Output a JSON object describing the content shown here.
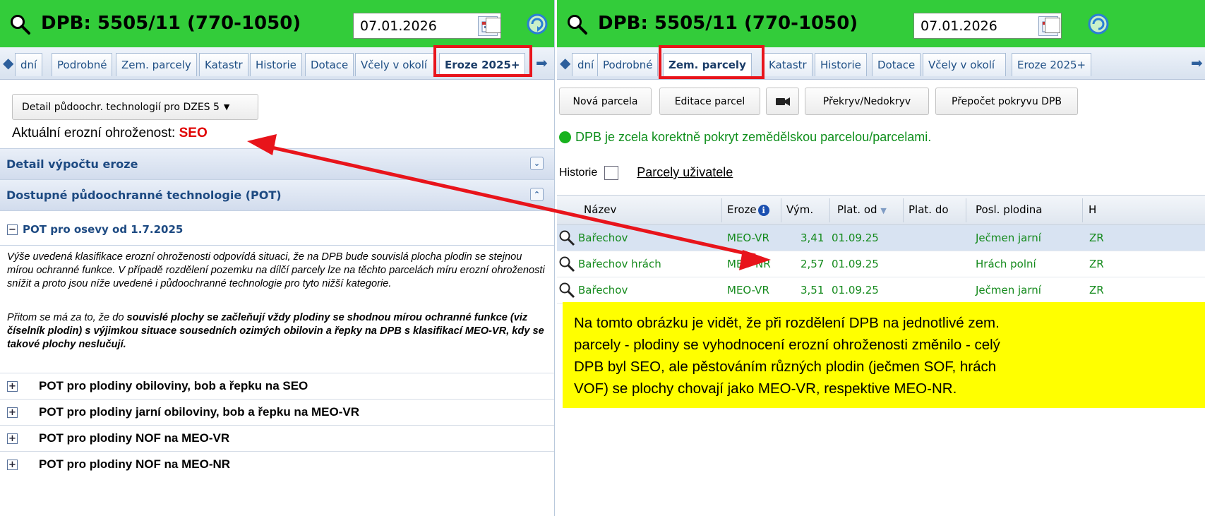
{
  "left": {
    "title": "DPB: 5505/11 (770-1050)",
    "date": "07.01.2026",
    "tabs": [
      "dní",
      "Podrobné",
      "Zem. parcely",
      "Katastr",
      "Historie",
      "Dotace",
      "Včely v okolí",
      "Eroze 2025+"
    ],
    "active_tab": "Eroze 2025+",
    "dropdown_label": "Detail půdoochr. technologií pro DZES 5",
    "erosion_label": "Aktuální erozní ohroženost:",
    "erosion_value": "SEO",
    "section_detail": "Detail výpočtu eroze",
    "section_pot": "Dostupné půdoochranné technologie (POT)",
    "pot_header": "POT pro osevy od 1.7.2025",
    "paragraph1": "Výše uvedená klasifikace erozní ohroženosti odpovídá situaci, že na DPB bude souvislá plocha plodin se stejnou mírou ochranné funkce. V případě rozdělení pozemku na dílčí parcely lze na těchto parcelách míru erozní ohroženosti snížit a proto jsou níže uvedené i půdoochranné technologie pro tyto nižší kategorie.",
    "paragraph2_start": "Přitom se má za to, že do ",
    "paragraph2_bold": "souvislé plochy se začleňují vždy plodiny se shodnou mírou ochranné funkce (viz číselník plodin) s výjimkou situace sousedních ozimých obilovin a řepky na DPB s klasifikací MEO-VR, kdy se takové plochy neslučují.",
    "pot_rows": [
      "POT pro plodiny obiloviny, bob a řepku na SEO",
      "POT pro plodiny jarní obiloviny, bob a řepku na MEO-VR",
      "POT pro plodiny NOF na MEO-VR",
      "POT pro plodiny NOF na MEO-NR"
    ]
  },
  "right": {
    "title": "DPB: 5505/11 (770-1050)",
    "date": "07.01.2026",
    "tabs": [
      "dní",
      "Podrobné",
      "Zem. parcely",
      "Katastr",
      "Historie",
      "Dotace",
      "Včely v okolí",
      "Eroze 2025+"
    ],
    "active_tab": "Zem. parcely",
    "buttons": {
      "new_parcel": "Nová parcela",
      "edit_parcels": "Editace parcel",
      "overlap": "Překryv/Nedokryv",
      "recalc": "Přepočet pokryvu DPB"
    },
    "status": "DPB je zcela korektně pokryt zemědělskou parcelou/parcelami.",
    "history_label": "Historie",
    "user_parcels_link": "Parcely uživatele",
    "columns": [
      "Název",
      "Eroze",
      "Vým.",
      "Plat. od",
      "Plat. do",
      "Posl. plodina",
      "H"
    ],
    "rows": [
      {
        "name": "Bařechov",
        "eroze": "MEO-VR",
        "vym": "3,41",
        "plat_od": "01.09.25",
        "plat_do": "",
        "plodina": "Ječmen jarní",
        "h": "ZR"
      },
      {
        "name": "Bařechov hrách",
        "eroze": "MEO-NR",
        "vym": "2,57",
        "plat_od": "01.09.25",
        "plat_do": "",
        "plodina": "Hrách polní",
        "h": "ZR"
      },
      {
        "name": "Bařechov",
        "eroze": "MEO-VR",
        "vym": "3,51",
        "plat_od": "01.09.25",
        "plat_do": "",
        "plodina": "Ječmen jarní",
        "h": "ZR"
      }
    ]
  },
  "note": {
    "line1": "Na tomto obrázku je vidět, že při rozdělení DPB na jednotlivé zem.",
    "line2": "parcely - plodiny se vyhodnocení erozní ohroženosti změnilo - celý",
    "line3": "DPB byl SEO, ale pěstováním různých plodin (ječmen SOF, hrách",
    "line4": "VOF) se plochy chovají jako MEO-VR, respektive MEO-NR."
  },
  "colors": {
    "title_bar": "#33cc3a",
    "highlight_box": "#e8141b",
    "seo": "#e00000",
    "note_bg": "#ffff00",
    "status_green": "#0f8f1c"
  },
  "icons": [
    "search-icon",
    "calendar-icon",
    "refresh-icon",
    "arrow-left-icon",
    "arrow-right-icon",
    "expand-icon",
    "collapse-icon",
    "camera-icon",
    "info-icon",
    "sort-desc-icon"
  ]
}
